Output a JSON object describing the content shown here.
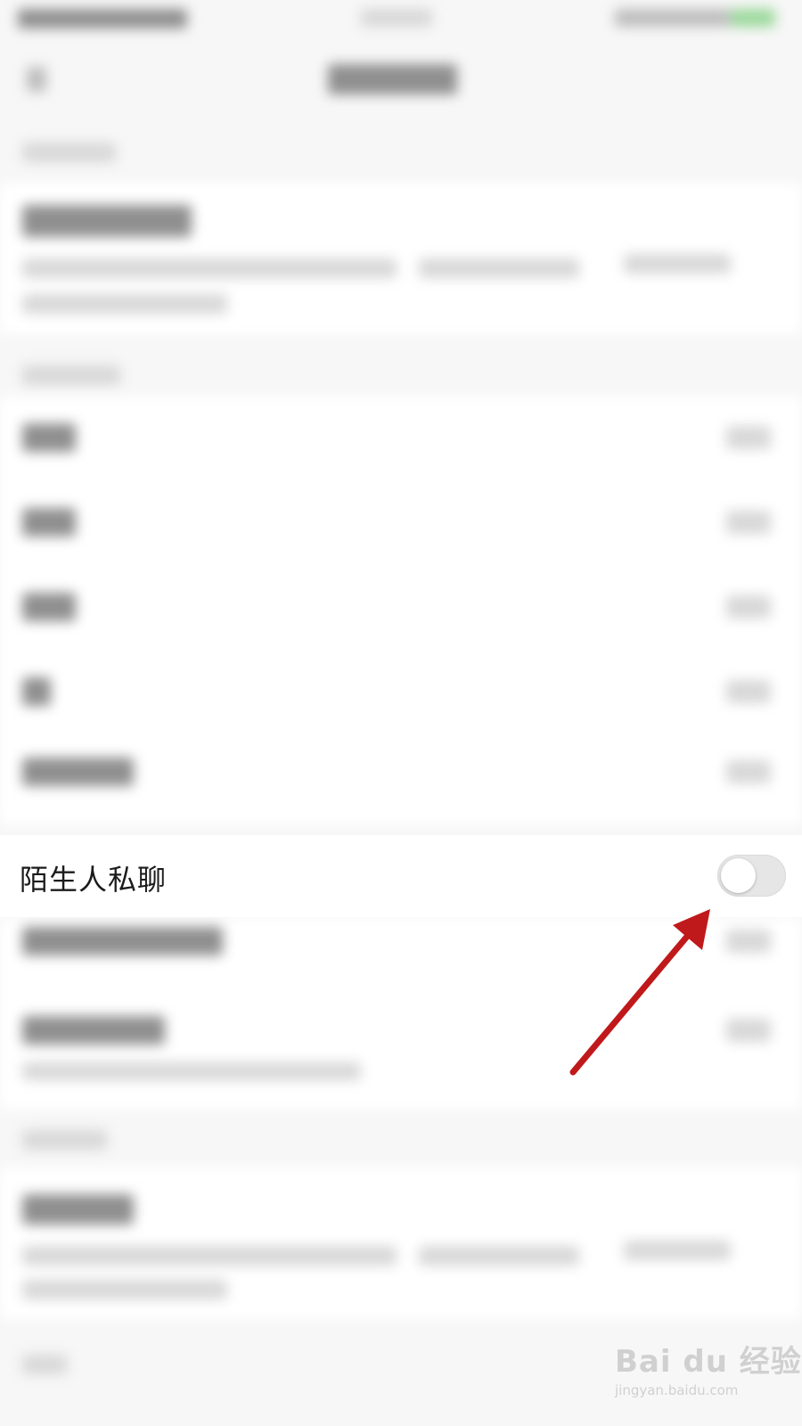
{
  "setting": {
    "label": "陌生人私聊",
    "toggle_state": "off"
  },
  "watermark": {
    "logo": "Bai du 经验",
    "url": "jingyan.baidu.com"
  },
  "colors": {
    "arrow": "#c0191b",
    "toggle_off_bg": "#e6e6e6",
    "label_text": "#1b1b1b"
  }
}
